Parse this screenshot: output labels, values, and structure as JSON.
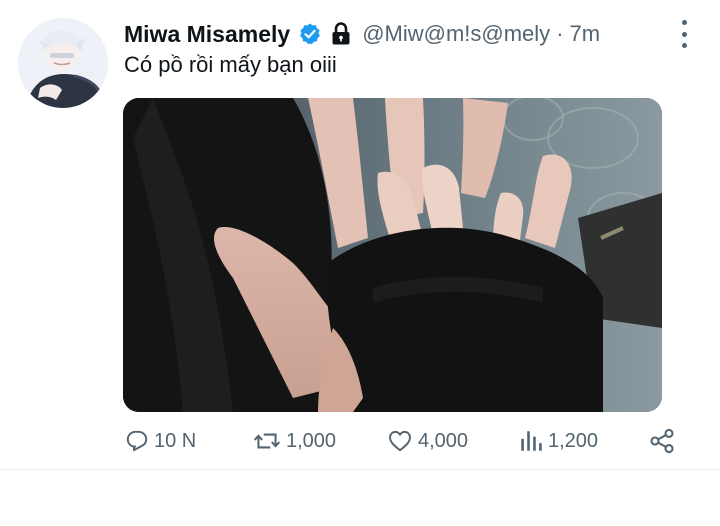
{
  "tweet": {
    "author_name": "Miwa Misamely",
    "handle": "@Miw@m!s@mely",
    "separator": "·",
    "time": "7m",
    "text": "Có pồ rồi mấy bạn oiii",
    "verified": true,
    "protected": true
  },
  "actions": {
    "reply_count": "10 N",
    "retweet_count": "1,000",
    "like_count": "4,000",
    "views_count": "1,200"
  },
  "colors": {
    "verified_blue": "#1d9bf0",
    "secondary_text": "#536471"
  }
}
